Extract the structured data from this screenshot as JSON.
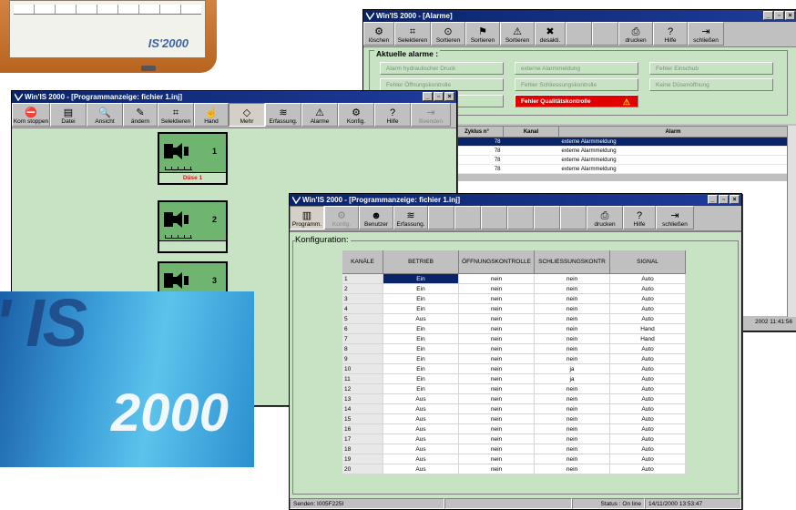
{
  "device": {
    "logo": "IS'2000"
  },
  "banner": {
    "text1": "' IS",
    "text2": "2000"
  },
  "alarm_window": {
    "title": "Win'IS 2000 - [Alarme]",
    "toolbar": [
      "löschen",
      "Selektieren",
      "Sortieren",
      "Sortieren",
      "Sortieren",
      "desakti.",
      "drucken",
      "Hilfe",
      "schließen"
    ],
    "group_title": "Aktuelle alarme :",
    "alarms": [
      {
        "label": "Alarm hydraulischer Druck",
        "active": false
      },
      {
        "label": "externe Alarmmeldung",
        "active": false
      },
      {
        "label": "Fehler Einschub",
        "active": false
      },
      {
        "label": "Fehler Öffnungskontrolle",
        "active": false
      },
      {
        "label": "Fehler Schliessungskontrolle",
        "active": false
      },
      {
        "label": "Keine Düsenöffnung",
        "active": false
      },
      {
        "label": "ung",
        "active": false
      },
      {
        "label": "Fehler Qualitätskontrolle",
        "active": true
      }
    ],
    "table_headers": [
      "Zyklus n°",
      "Kanal",
      "Alarm"
    ],
    "rows": [
      {
        "zyklus": "78",
        "kanal": "",
        "alarm": "externe Alarmmeldung",
        "selected": true
      },
      {
        "zyklus": "78",
        "kanal": "",
        "alarm": "externe Alarmmeldung",
        "selected": false
      },
      {
        "zyklus": "78",
        "kanal": "",
        "alarm": "externe Alarmmeldung",
        "selected": false
      },
      {
        "zyklus": "78",
        "kanal": "",
        "alarm": "externe Alarmmeldung",
        "selected": false
      }
    ],
    "status_time": "2002 11:41:56"
  },
  "program_window": {
    "title": "Win'IS 2000 - [Programmanzeige: fichier 1.inj]",
    "toolbar": [
      "Kom stoppen",
      "Datei",
      "Ansicht",
      "ändern",
      "Selektieren",
      "Hand",
      "Mehr",
      "Erfassung.",
      "Alarme",
      "Konfig.",
      "Hilfe",
      "Beenden"
    ],
    "devices": [
      {
        "number": "1",
        "label": "Düse 1"
      },
      {
        "number": "2",
        "label": ""
      },
      {
        "number": "3",
        "label": ""
      }
    ]
  },
  "konfig_window": {
    "title": "Win'IS 2000 - [Programmanzeige: fichier 1.inj]",
    "toolbar": [
      "Programm.",
      "Konfig.",
      "Benutzer",
      "Erfassung.",
      "drucken",
      "Hilfe",
      "schließen"
    ],
    "section_title": "Konfiguration:",
    "columns": [
      "KANÄLE",
      "BETRIEB",
      "ÖFFNUNGSKONTROLLE",
      "SCHLIESSUNGSKONTR",
      "SIGNAL"
    ],
    "rows": [
      [
        "1",
        "Ein",
        "nein",
        "nein",
        "Auto"
      ],
      [
        "2",
        "Ein",
        "nein",
        "nein",
        "Auto"
      ],
      [
        "3",
        "Ein",
        "nein",
        "nein",
        "Auto"
      ],
      [
        "4",
        "Ein",
        "nein",
        "nein",
        "Auto"
      ],
      [
        "5",
        "Aus",
        "nein",
        "nein",
        "Auto"
      ],
      [
        "6",
        "Ein",
        "nein",
        "nein",
        "Hand"
      ],
      [
        "7",
        "Ein",
        "nein",
        "nein",
        "Hand"
      ],
      [
        "8",
        "Ein",
        "nein",
        "nein",
        "Auto"
      ],
      [
        "9",
        "Ein",
        "nein",
        "nein",
        "Auto"
      ],
      [
        "10",
        "Ein",
        "nein",
        "ja",
        "Auto"
      ],
      [
        "11",
        "Ein",
        "nein",
        "ja",
        "Auto"
      ],
      [
        "12",
        "Ein",
        "nein",
        "nein",
        "Auto"
      ],
      [
        "13",
        "Aus",
        "nein",
        "nein",
        "Auto"
      ],
      [
        "14",
        "Aus",
        "nein",
        "nein",
        "Auto"
      ],
      [
        "15",
        "Aus",
        "nein",
        "nein",
        "Auto"
      ],
      [
        "16",
        "Aus",
        "nein",
        "nein",
        "Auto"
      ],
      [
        "17",
        "Aus",
        "nein",
        "nein",
        "Auto"
      ],
      [
        "18",
        "Aus",
        "nein",
        "nein",
        "Auto"
      ],
      [
        "19",
        "Aus",
        "nein",
        "nein",
        "Auto"
      ],
      [
        "20",
        "Aus",
        "nein",
        "nein",
        "Auto"
      ]
    ],
    "status": {
      "sender": "Senden: I005F225I",
      "state": "Status : On line",
      "datetime": "14/11/2000 13:53:47"
    }
  },
  "colors": {
    "title_bar": "#0a246a",
    "panel_green": "#c7e3c3",
    "alarm_red": "#e00000",
    "selection": "#0a246a"
  }
}
